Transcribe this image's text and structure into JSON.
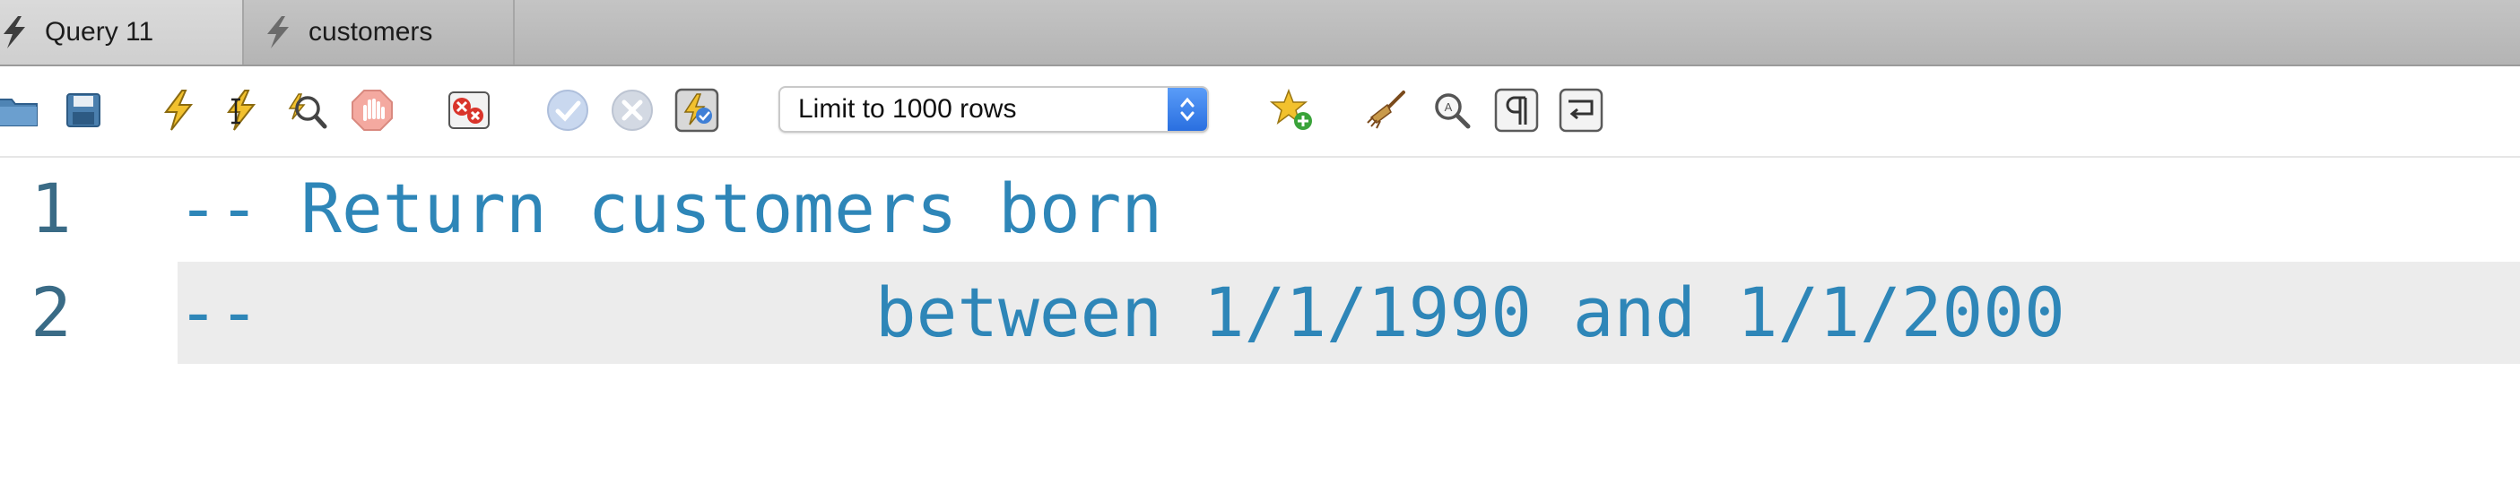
{
  "tabs": [
    {
      "label": "Query 11",
      "active": true,
      "icon": "bolt-icon"
    },
    {
      "label": "customers",
      "active": false,
      "icon": "bolt-icon"
    }
  ],
  "toolbar": {
    "buttons": [
      {
        "name": "open-folder-button",
        "icon": "folder-icon"
      },
      {
        "name": "save-button",
        "icon": "save-icon"
      },
      {
        "name": "execute-button",
        "icon": "lightning-icon"
      },
      {
        "name": "execute-current-button",
        "icon": "lightning-cursor-icon"
      },
      {
        "name": "explain-button",
        "icon": "magnify-lightning-icon"
      },
      {
        "name": "stop-button",
        "icon": "stop-hand-icon"
      },
      {
        "name": "toggle-error-button",
        "icon": "error-x-icon"
      },
      {
        "name": "commit-button",
        "icon": "check-circle-icon"
      },
      {
        "name": "rollback-button",
        "icon": "x-circle-icon"
      },
      {
        "name": "autocommit-toggle",
        "icon": "autocommit-icon"
      },
      {
        "name": "add-snippet-button",
        "icon": "star-plus-icon"
      },
      {
        "name": "beautify-button",
        "icon": "broom-icon"
      },
      {
        "name": "find-button",
        "icon": "find-icon"
      },
      {
        "name": "invisible-chars-button",
        "icon": "pilcrow-icon"
      },
      {
        "name": "wrap-lines-button",
        "icon": "wrap-icon"
      }
    ],
    "limit": {
      "label": "Limit to 1000 rows",
      "accent": "#2f76e6"
    }
  },
  "editor": {
    "lines": [
      {
        "number": "1",
        "text": "-- Return customers born"
      },
      {
        "number": "2",
        "text": "--               between 1/1/1990 and 1/1/2000"
      }
    ],
    "comment_color": "#2e86b8",
    "line_number_color": "#3a6b86",
    "current_line_color": "#ececec"
  }
}
